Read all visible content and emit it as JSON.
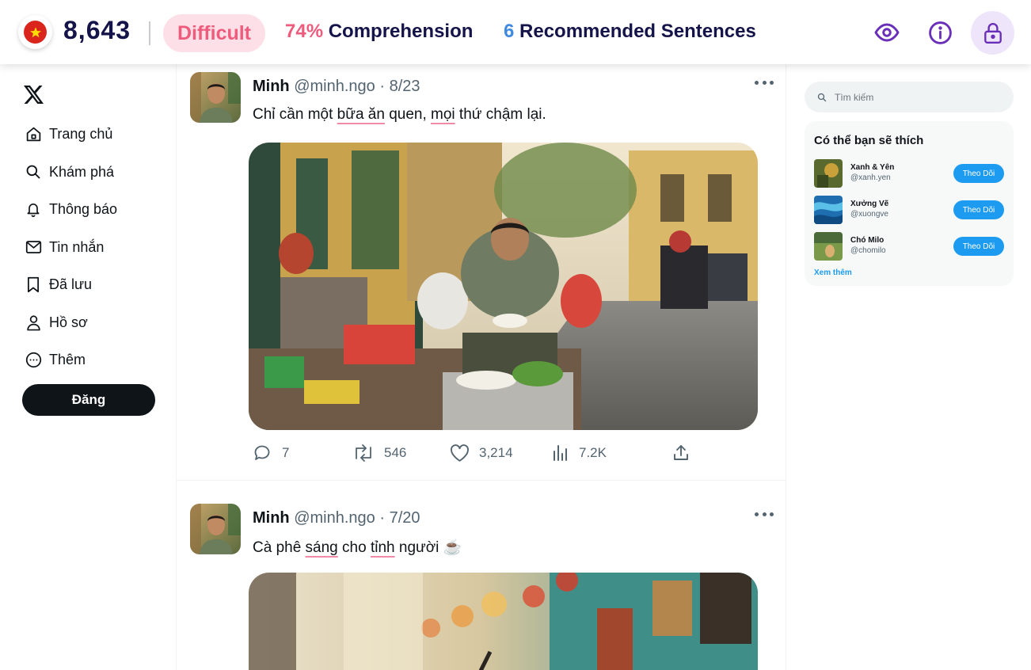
{
  "topbar": {
    "flag_icon": "vietnam-flag-icon",
    "score": "8,643",
    "difficulty": "Difficult",
    "comprehension_pct": "74%",
    "comprehension_label": "Comprehension",
    "recommended_count": "6",
    "recommended_label": "Recommended Sentences",
    "icons": [
      "eye-icon",
      "info-icon",
      "lock-icon"
    ],
    "colors": {
      "navy": "#15144a",
      "pink": "#ef5b7c",
      "blue": "#3f8ae0",
      "purple": "#6a2fb8"
    }
  },
  "sidebar": {
    "logo": "x-logo-icon",
    "items": [
      {
        "label": "Trang chủ",
        "icon": "home-icon"
      },
      {
        "label": "Khám phá",
        "icon": "search-icon"
      },
      {
        "label": "Thông báo",
        "icon": "bell-icon"
      },
      {
        "label": "Tin nhắn",
        "icon": "mail-icon"
      },
      {
        "label": "Đã lưu",
        "icon": "bookmark-icon"
      },
      {
        "label": "Hồ sơ",
        "icon": "person-icon"
      },
      {
        "label": "Thêm",
        "icon": "more-circle-icon"
      }
    ],
    "post_button": "Đăng"
  },
  "feed": {
    "tweets": [
      {
        "name": "Minh",
        "handle": "@minh.ngo",
        "dot": "·",
        "date": "8/23",
        "text_parts": [
          "Chỉ cần một ",
          "bữa ăn",
          " quen, ",
          "mọi",
          " thứ chậm lại."
        ],
        "replies": "7",
        "retweets": "546",
        "likes": "3,214",
        "views": "7.2K"
      },
      {
        "name": "Minh",
        "handle": "@minh.ngo",
        "dot": "·",
        "date": "7/20",
        "text_parts": [
          "Cà phê ",
          "sáng",
          " cho ",
          "tỉnh",
          " người ☕"
        ]
      }
    ]
  },
  "right": {
    "search_placeholder": "Tìm kiếm",
    "suggest_title": "Có thể bạn sẽ thích",
    "suggestions": [
      {
        "name": "Xanh & Yên",
        "handle": "@xanh.yen",
        "follow": "Theo Dõi"
      },
      {
        "name": "Xưởng Vẽ",
        "handle": "@xuongve",
        "follow": "Theo Dõi"
      },
      {
        "name": "Chó Milo",
        "handle": "@chomilo",
        "follow": "Theo Dõi"
      }
    ],
    "see_more": "Xem thêm"
  }
}
